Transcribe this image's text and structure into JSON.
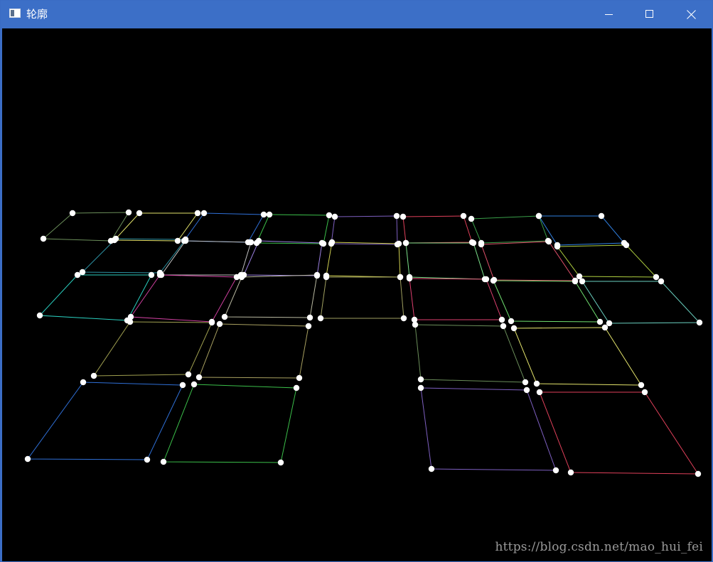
{
  "window": {
    "title": "轮廓",
    "icon": "app-window-icon",
    "controls": {
      "minimize": "minimize-icon",
      "maximize": "maximize-icon",
      "close": "close-icon"
    }
  },
  "colors": {
    "titlebar": "#3c6fc7",
    "canvas_background": "#000000",
    "point_fill": "#ffffff",
    "watermark": "#9a9a9a",
    "contour_colors": [
      "#6b8e5a",
      "#e3e36b",
      "#2f6fd6",
      "#3bbf4a",
      "#7d5fc0",
      "#e0405a",
      "#3aa04a",
      "#2f7fe0",
      "#2c8fa0",
      "#c0c0c0",
      "#9a7fe0",
      "#d0d050",
      "#7be08a",
      "#e0506a",
      "#b0d040",
      "#2ad0c0",
      "#d040a0",
      "#b8b8a0",
      "#a0a060",
      "#e04070",
      "#70e070",
      "#6ad0c0",
      "#a0a050",
      "#a8a060"
    ]
  },
  "canvas": {
    "description_type": "contour-drawing",
    "watermark": "https://blog.csdn.net/mao_hui_fei"
  }
}
